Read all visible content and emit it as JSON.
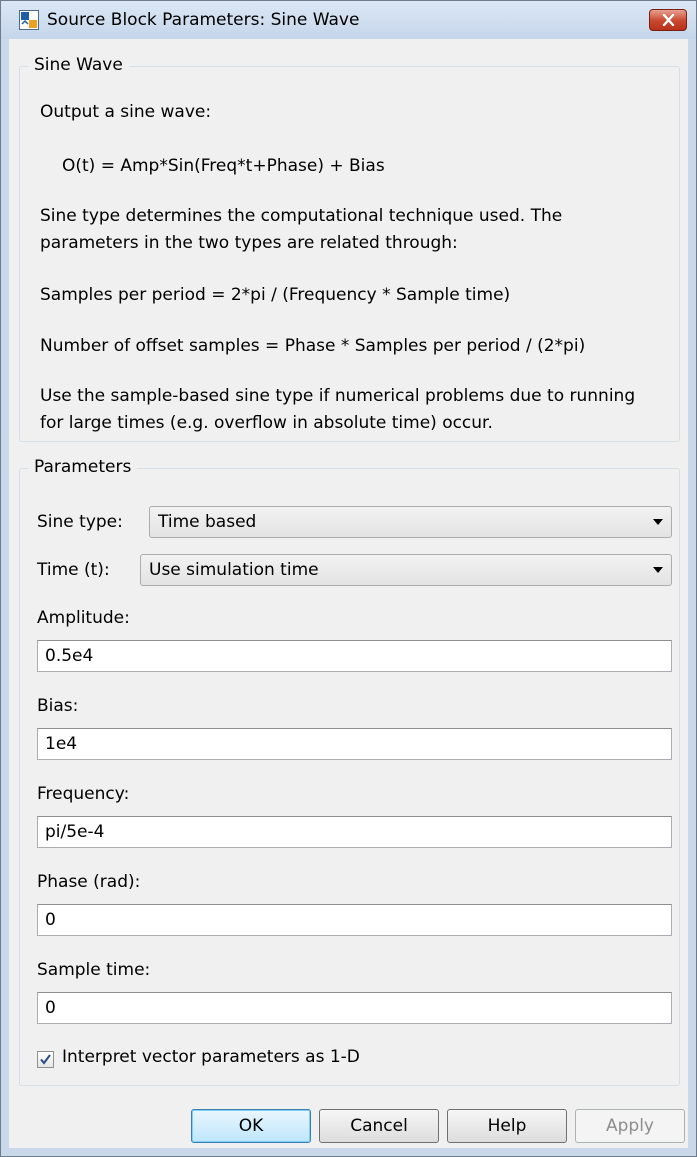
{
  "window": {
    "title": "Source Block Parameters: Sine Wave"
  },
  "description": {
    "group_title": "Sine Wave",
    "lines": [
      "Output a sine wave:",
      "O(t) = Amp*Sin(Freq*t+Phase) + Bias",
      "Sine type determines the computational technique used. The",
      "parameters in the two types are related through:",
      "Samples per period = 2*pi / (Frequency * Sample time)",
      "Number of offset samples = Phase * Samples per period / (2*pi)",
      "Use the sample-based sine type if numerical problems due to running",
      "for large times (e.g. overflow in absolute time) occur."
    ]
  },
  "parameters": {
    "group_title": "Parameters",
    "sine_type": {
      "label": "Sine type:",
      "value": "Time based"
    },
    "time": {
      "label": "Time (t):",
      "value": "Use simulation time"
    },
    "amplitude": {
      "label": "Amplitude:",
      "value": "0.5e4"
    },
    "bias": {
      "label": "Bias:",
      "value": "1e4"
    },
    "frequency": {
      "label": "Frequency:",
      "value": "pi/5e-4"
    },
    "phase": {
      "label": "Phase (rad):",
      "value": "0"
    },
    "sample_time": {
      "label": "Sample time:",
      "value": "0"
    },
    "interpret_vector": {
      "label": "Interpret vector parameters as 1-D",
      "checked": true
    }
  },
  "buttons": {
    "ok": "OK",
    "cancel": "Cancel",
    "help": "Help",
    "apply": "Apply"
  },
  "icons": {
    "title_icon": "simulink-block-icon",
    "close": "close-icon",
    "dropdown": "chevron-down-icon",
    "check": "checkmark-icon"
  },
  "colors": {
    "titlebar": "#c9d8ea",
    "close_button": "#c9472d",
    "dialog_background": "#f0f0f0",
    "checkmark": "#2a4a8a"
  }
}
